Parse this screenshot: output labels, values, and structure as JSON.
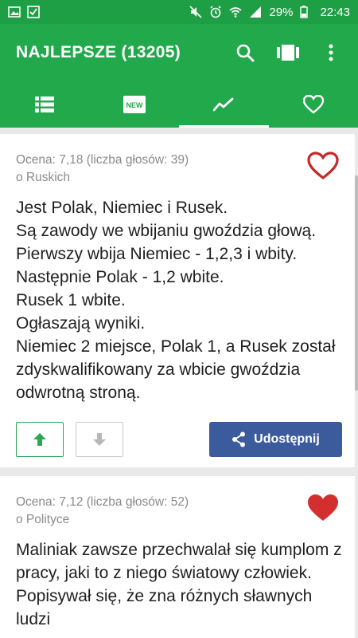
{
  "status_bar": {
    "battery": "29%",
    "time": "22:43"
  },
  "app_bar": {
    "title": "NAJLEPSZE (13205)"
  },
  "tabs": [
    {
      "name": "list",
      "icon": "list-icon"
    },
    {
      "name": "new",
      "icon": "new-badge-icon",
      "badge": "NEW"
    },
    {
      "name": "trending",
      "icon": "trending-icon",
      "active": true
    },
    {
      "name": "favorites",
      "icon": "heart-outline-icon"
    }
  ],
  "jokes": [
    {
      "meta": "Ocena: 7,18 (liczba głosów: 39)",
      "category": "o Ruskich",
      "favorite": false,
      "text": "Jest Polak, Niemiec i Rusek.\nSą zawody we wbijaniu gwoździa głową.\nPierwszy wbija Niemiec - 1,2,3 i wbity.\nNastępnie Polak - 1,2 wbite.\nRusek 1 wbite.\nOgłaszają wyniki.\nNiemiec 2 miejsce, Polak 1, a Rusek został zdyskwalifikowany za wbicie gwoździa odwrotną stroną.",
      "share_label": "Udostępnij"
    },
    {
      "meta": "Ocena: 7,12 (liczba głosów: 52)",
      "category": "o Polityce",
      "favorite": true,
      "text": "Maliniak zawsze przechwalał się kumplom z pracy, jaki to z niego światowy człowiek.\nPopisywał się, że zna różnych sławnych ludzi"
    }
  ],
  "colors": {
    "primary": "#21a94b",
    "status_bar": "#1e9e45",
    "heart": "#d32f2f",
    "share": "#3c5b9c",
    "upvote": "#2da652"
  }
}
